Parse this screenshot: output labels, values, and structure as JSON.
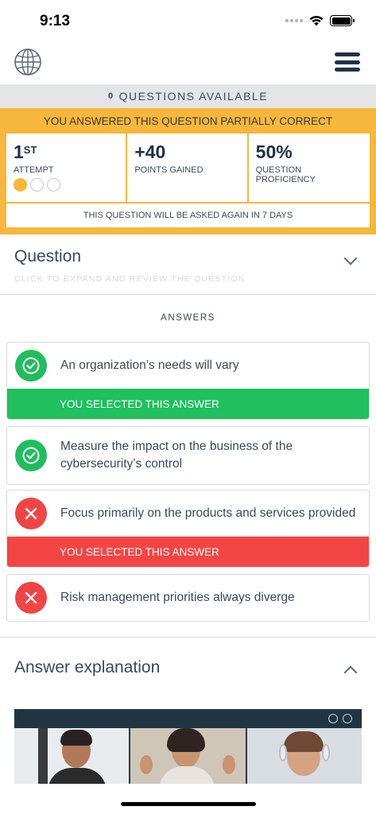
{
  "status_bar": {
    "time": "9:13"
  },
  "header": {
    "globe_icon": "globe-icon",
    "menu_icon": "hamburger-menu-icon"
  },
  "questions_available": {
    "count": "0",
    "label": "QUESTIONS AVAILABLE"
  },
  "result": {
    "title": "YOU ANSWERED THIS QUESTION PARTIALLY CORRECT",
    "attempt": {
      "value": "1",
      "suffix": "ST",
      "label": "ATTEMPT",
      "dots_total": 3,
      "dots_filled": 1
    },
    "points": {
      "value": "+40",
      "label": "POINTS GAINED"
    },
    "proficiency": {
      "value": "50%",
      "label": "QUESTION PROFICIENCY"
    },
    "repeat_note": "THIS QUESTION WILL BE ASKED AGAIN IN 7 DAYS",
    "accent_color": "#f6b73c"
  },
  "question": {
    "title": "Question",
    "subtitle": "CLICK TO EXPAND AND REVIEW THE QUESTION"
  },
  "answers": {
    "label": "ANSWERS",
    "items": [
      {
        "text": "An organization’s needs will vary",
        "correct": true,
        "selected": true,
        "selected_label": "YOU SELECTED THIS ANSWER"
      },
      {
        "text": "Measure the impact on the business of the cybersecurity’s control",
        "correct": true,
        "selected": false
      },
      {
        "text": "Focus primarily on the products and services provided",
        "correct": false,
        "selected": true,
        "selected_label": "YOU SELECTED THIS ANSWER"
      },
      {
        "text": "Risk management priorities always diverge",
        "correct": false,
        "selected": false
      }
    ],
    "colors": {
      "correct": "#20bd5f",
      "incorrect": "#f04545"
    }
  },
  "explanation": {
    "title": "Answer explanation"
  }
}
